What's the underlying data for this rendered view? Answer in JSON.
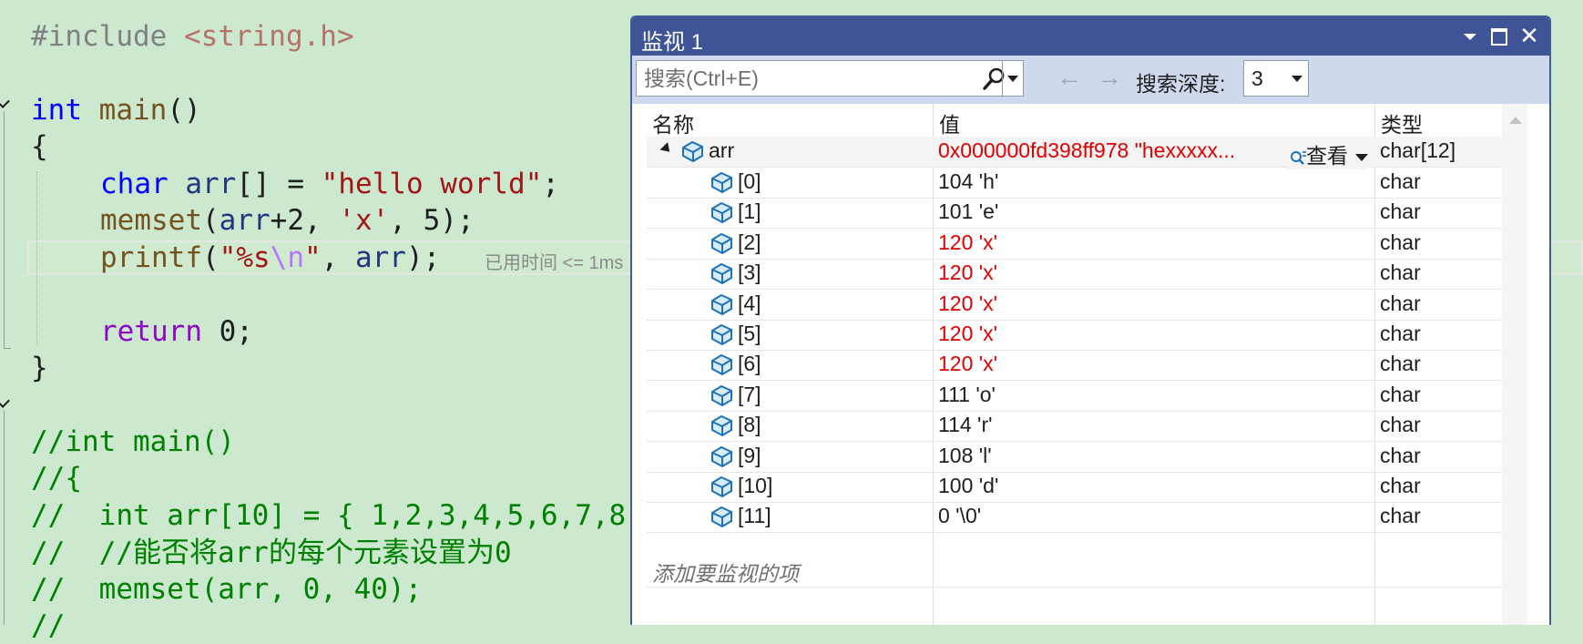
{
  "editor": {
    "lines": {
      "l1": {
        "pre": "#include ",
        "inc": "<string.h>"
      },
      "l2": {
        "kw": "int",
        "fn": "main",
        "rest": "()"
      },
      "l3": {
        "brace": "{"
      },
      "l4": {
        "kw": "char",
        "var": "arr",
        "mid": "[] = ",
        "str": "\"hello world\"",
        "end": ";"
      },
      "l5": {
        "fn": "memset",
        "p1": "(",
        "var": "arr",
        "p2": "+2, ",
        "str": "'x'",
        "p3": ", 5);"
      },
      "l6": {
        "fn": "printf",
        "p1": "(",
        "str1": "\"%s",
        "esc": "\\n",
        "str2": "\"",
        "p2": ", ",
        "var": "arr",
        "p3": ");"
      },
      "l7": {
        "kw": "return",
        "rest": " 0;"
      },
      "l8": {
        "brace": "}"
      },
      "c1": "//int main()",
      "c2": "//{",
      "c3": "//  int arr[10] = { 1,2,3,4,5,6,7,8",
      "c4": "//  //能否将arr的每个元素设置为0",
      "c5": "//  memset(arr, 0, 40);",
      "c6": "//"
    },
    "inline_hint": "已用时间 <= 1ms"
  },
  "watch": {
    "title": "监视 1",
    "close_glyph": "✕",
    "search_placeholder": "搜索(Ctrl+E)",
    "back_glyph": "←",
    "forward_glyph": "→",
    "depth_label": "搜索深度:",
    "depth_value": "3",
    "columns": {
      "name": "名称",
      "value": "值",
      "type": "类型"
    },
    "root": {
      "name": "arr",
      "value": "0x000000fd398ff978 \"hexxxxx...",
      "view_label": "查看",
      "type": "char[12]"
    },
    "rows": [
      {
        "name": "[0]",
        "value": "104 'h'",
        "type": "char",
        "changed": false
      },
      {
        "name": "[1]",
        "value": "101 'e'",
        "type": "char",
        "changed": false
      },
      {
        "name": "[2]",
        "value": "120 'x'",
        "type": "char",
        "changed": true
      },
      {
        "name": "[3]",
        "value": "120 'x'",
        "type": "char",
        "changed": true
      },
      {
        "name": "[4]",
        "value": "120 'x'",
        "type": "char",
        "changed": true
      },
      {
        "name": "[5]",
        "value": "120 'x'",
        "type": "char",
        "changed": true
      },
      {
        "name": "[6]",
        "value": "120 'x'",
        "type": "char",
        "changed": true
      },
      {
        "name": "[7]",
        "value": "111 'o'",
        "type": "char",
        "changed": false
      },
      {
        "name": "[8]",
        "value": "114 'r'",
        "type": "char",
        "changed": false
      },
      {
        "name": "[9]",
        "value": "108 'l'",
        "type": "char",
        "changed": false
      },
      {
        "name": "[10]",
        "value": "100 'd'",
        "type": "char",
        "changed": false
      },
      {
        "name": "[11]",
        "value": "0 '\\0'",
        "type": "char",
        "changed": false
      }
    ],
    "add_item_placeholder": "添加要监视的项"
  },
  "icons": {
    "variable": "variable-icon",
    "search": "search-icon",
    "view": "visualizer-icon"
  },
  "colors": {
    "editor_bg": "#cce8cf",
    "title_bar": "#3f5496",
    "changed_value": "#e00000"
  }
}
